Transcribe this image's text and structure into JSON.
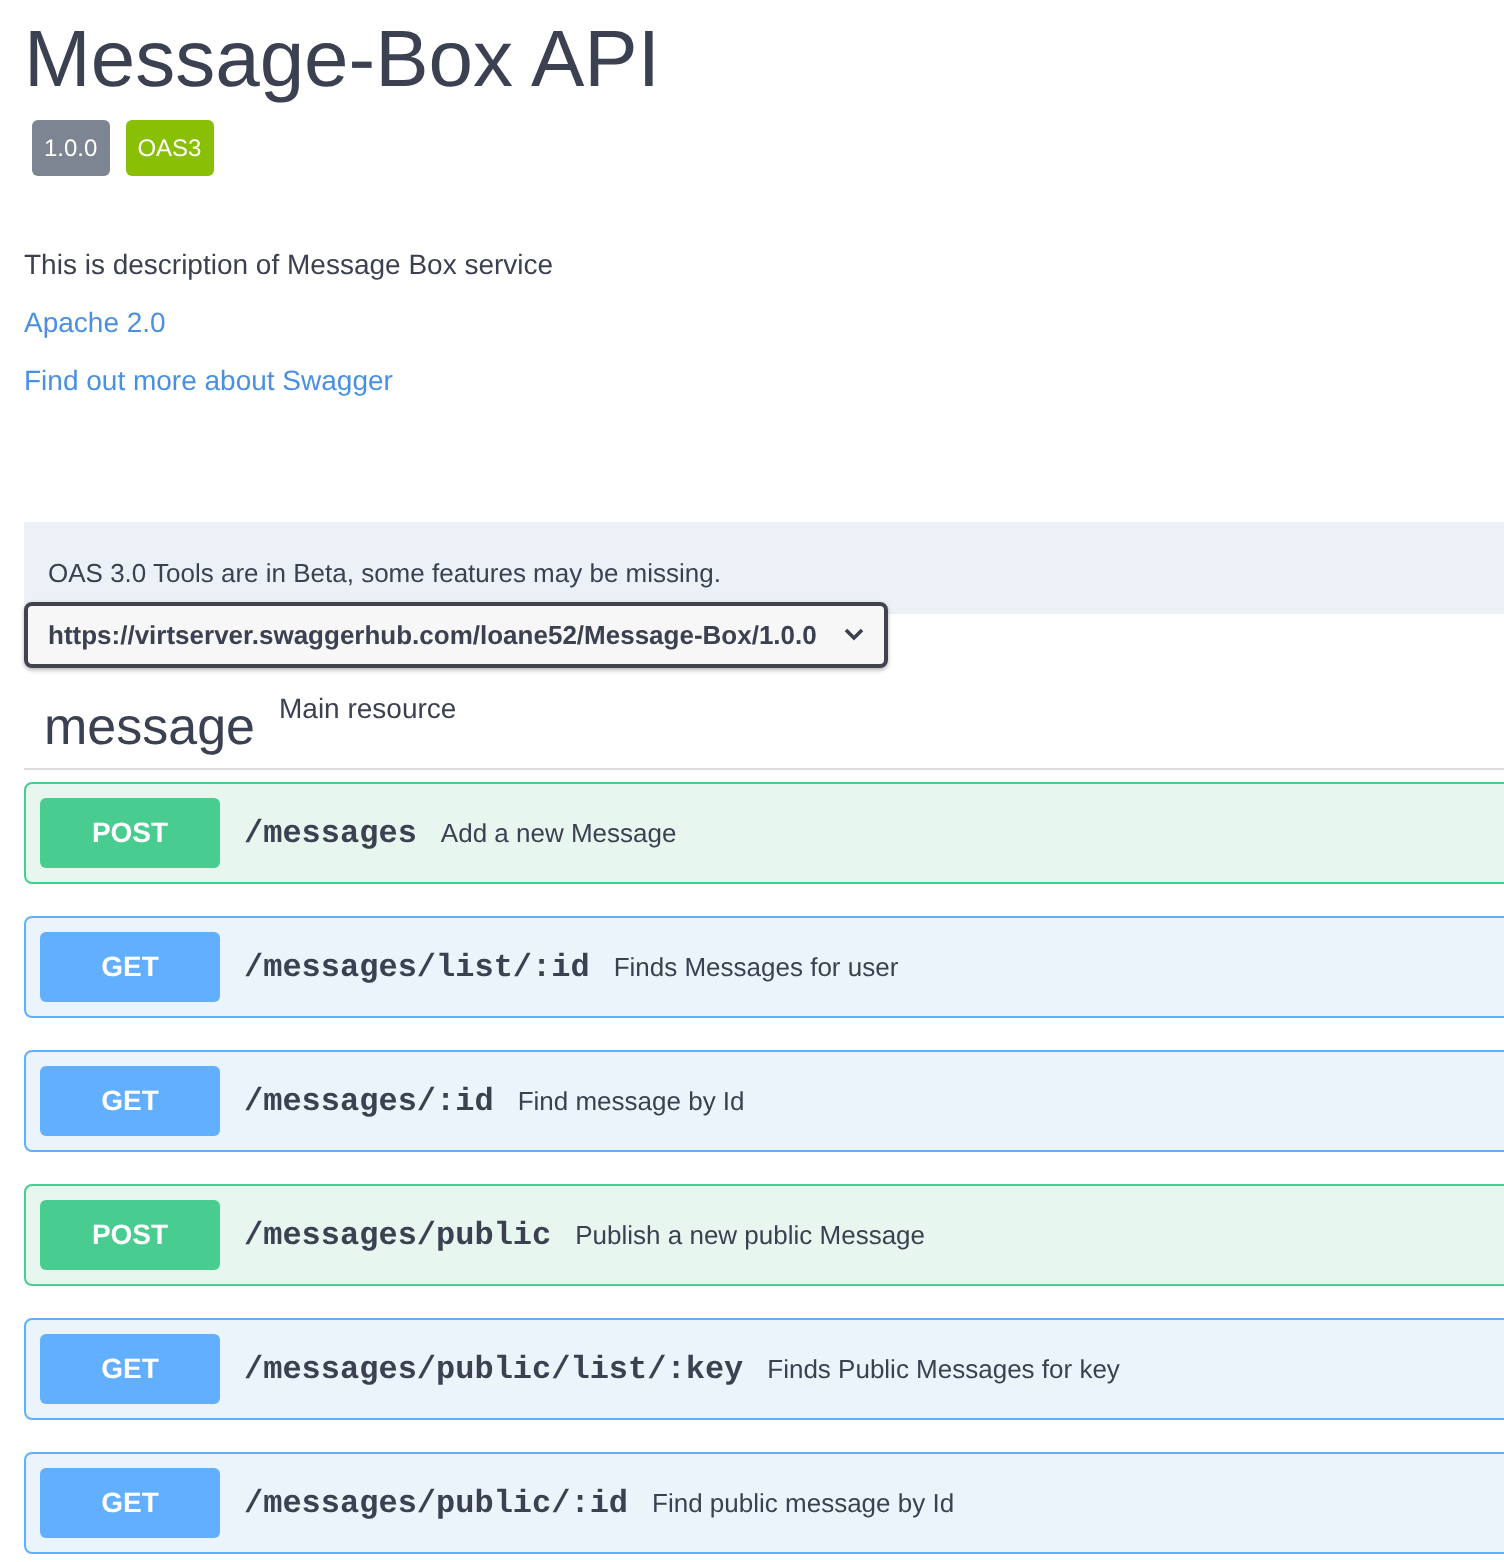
{
  "title": "Message-Box API",
  "badges": [
    {
      "text": "1.0.0",
      "kind": "version"
    },
    {
      "text": "OAS3",
      "kind": "spec"
    }
  ],
  "description": "This is description of Message Box service",
  "links": [
    "Apache 2.0",
    "Find out more about Swagger"
  ],
  "banner": "OAS 3.0 Tools are in Beta, some features may be missing.",
  "server_select": {
    "value": "https://virtserver.swaggerhub.com/loane52/Message-Box/1.0.0"
  },
  "tag": {
    "name": "message",
    "description": "Main resource"
  },
  "operations": [
    {
      "method": "POST",
      "kind": "post",
      "path": "/messages",
      "summary": "Add a new Message"
    },
    {
      "method": "GET",
      "kind": "get",
      "path": "/messages/list/:id",
      "summary": "Finds Messages for user"
    },
    {
      "method": "GET",
      "kind": "get",
      "path": "/messages/:id",
      "summary": "Find message by Id"
    },
    {
      "method": "POST",
      "kind": "post",
      "path": "/messages/public",
      "summary": "Publish a new public Message"
    },
    {
      "method": "GET",
      "kind": "get",
      "path": "/messages/public/list/:key",
      "summary": "Finds Public Messages for key"
    },
    {
      "method": "GET",
      "kind": "get",
      "path": "/messages/public/:id",
      "summary": "Find public message by Id"
    }
  ]
}
